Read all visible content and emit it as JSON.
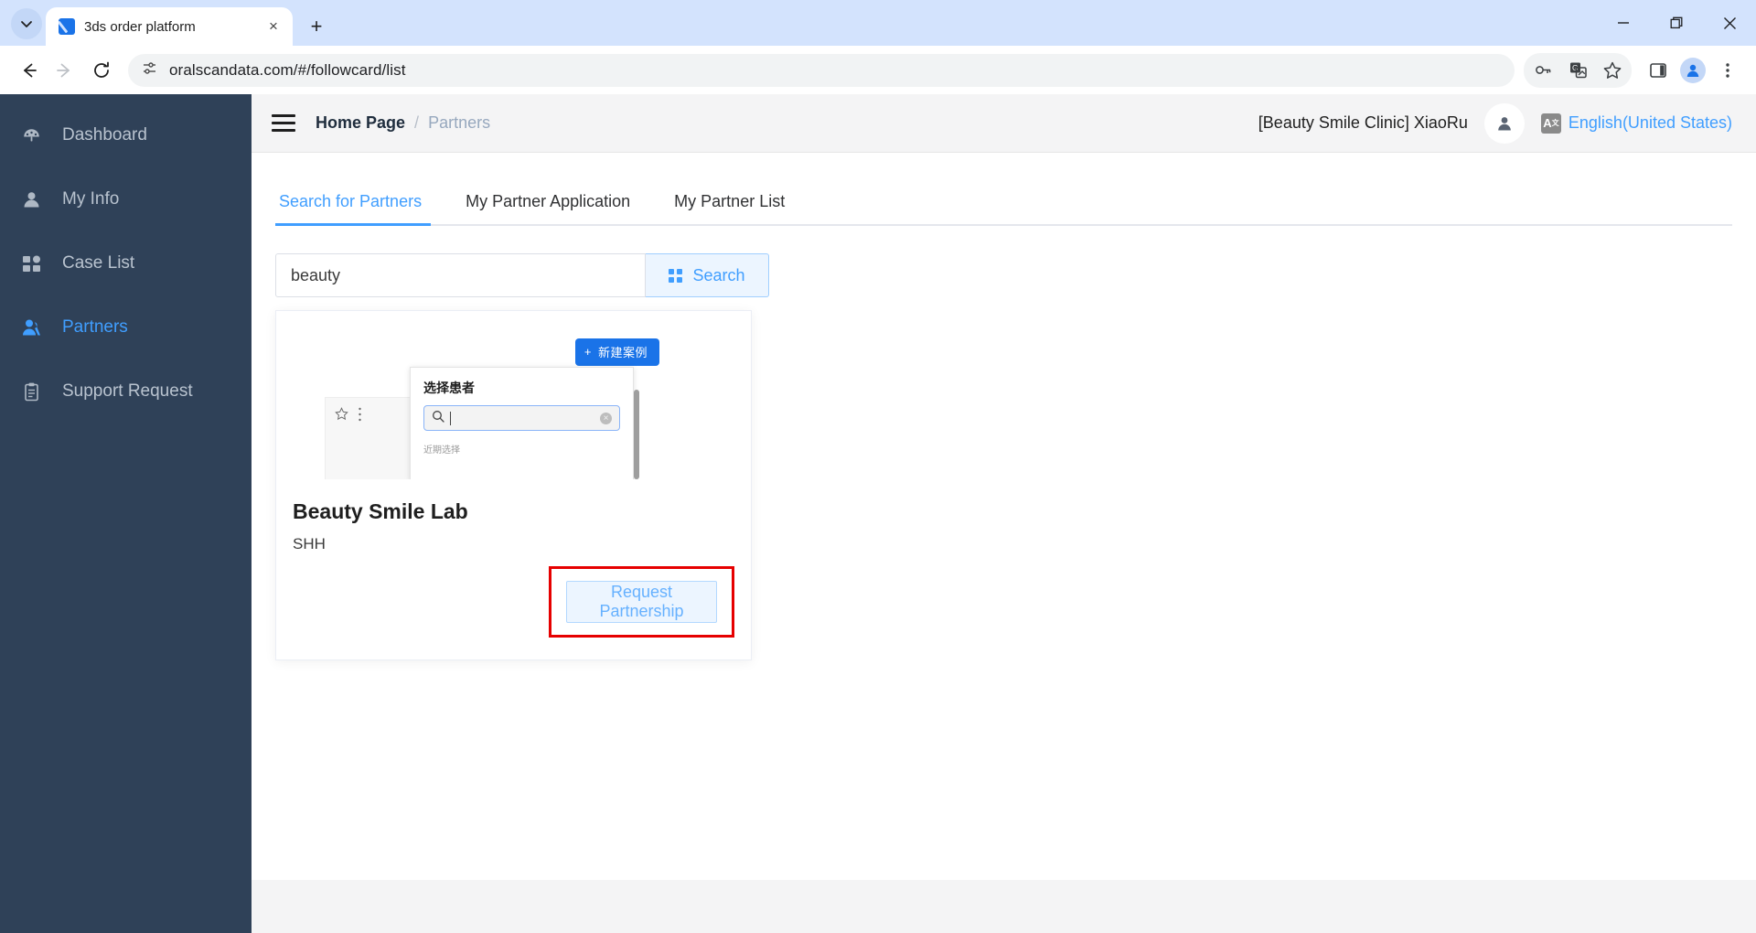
{
  "browser": {
    "tab": {
      "title": "3ds order platform",
      "favicon": "page-favicon-icon",
      "close": "×"
    },
    "new_tab": "+",
    "tab_list_chevron": "chevron-down-icon",
    "nav": {
      "back": "back-arrow-icon",
      "forward": "forward-arrow-icon",
      "reload": "reload-icon"
    },
    "omnibox": {
      "url": "oralscandata.com/#/followcard/list",
      "site_info": "site-settings-icon"
    },
    "toolbar_icons": [
      "password-key-icon",
      "translate-icon",
      "bookmark-star-icon",
      "side-panel-icon",
      "profile-avatar-icon",
      "chrome-menu-icon"
    ],
    "window": {
      "minimize": "–",
      "maximize": "▢",
      "close": "✕"
    }
  },
  "sidebar": {
    "items": [
      {
        "label": "Dashboard",
        "icon": "dashboard-gauge-icon",
        "active": false
      },
      {
        "label": "My Info",
        "icon": "user-icon",
        "active": false
      },
      {
        "label": "Case List",
        "icon": "grid-blocks-icon",
        "active": false
      },
      {
        "label": "Partners",
        "icon": "users-group-icon",
        "active": true
      },
      {
        "label": "Support Request",
        "icon": "clipboard-icon",
        "active": false
      }
    ],
    "bg_color": "#2f4158",
    "active_color": "#409eff"
  },
  "topbar": {
    "menu_toggle": "hamburger-menu-icon",
    "breadcrumb": {
      "home": "Home Page",
      "separator": "/",
      "current": "Partners"
    },
    "user_name": "[Beauty Smile Clinic] XiaoRu",
    "avatar_icon": "user-avatar-icon",
    "language": {
      "badge": "A",
      "badge_sup": "文",
      "label": "English(United States)"
    }
  },
  "main": {
    "tabs": [
      {
        "label": "Search for Partners",
        "active": true
      },
      {
        "label": "My Partner Application",
        "active": false
      },
      {
        "label": "My Partner List",
        "active": false
      }
    ],
    "search": {
      "value": "beauty",
      "placeholder": "",
      "button_label": "Search",
      "button_icon": "grid-search-icon"
    },
    "cards": [
      {
        "title": "Beauty Smile Lab",
        "subtitle": "SHH",
        "action_label": "Request Partnership",
        "highlighted": true,
        "thumbnail": {
          "new_case_button": "新建案例",
          "new_case_plus": "+",
          "panel_title": "选择患者",
          "panel_search_icon": "search-icon",
          "panel_clear_icon": "clear-circle-icon",
          "panel_recent_label": "近期选择",
          "left_card_star": "star-outline-icon",
          "left_card_more": "more-vertical-icon"
        }
      }
    ]
  },
  "colors": {
    "accent": "#409eff",
    "sidebar": "#2f4158",
    "highlight": "#e60000",
    "button_bg": "#ecf5ff"
  }
}
